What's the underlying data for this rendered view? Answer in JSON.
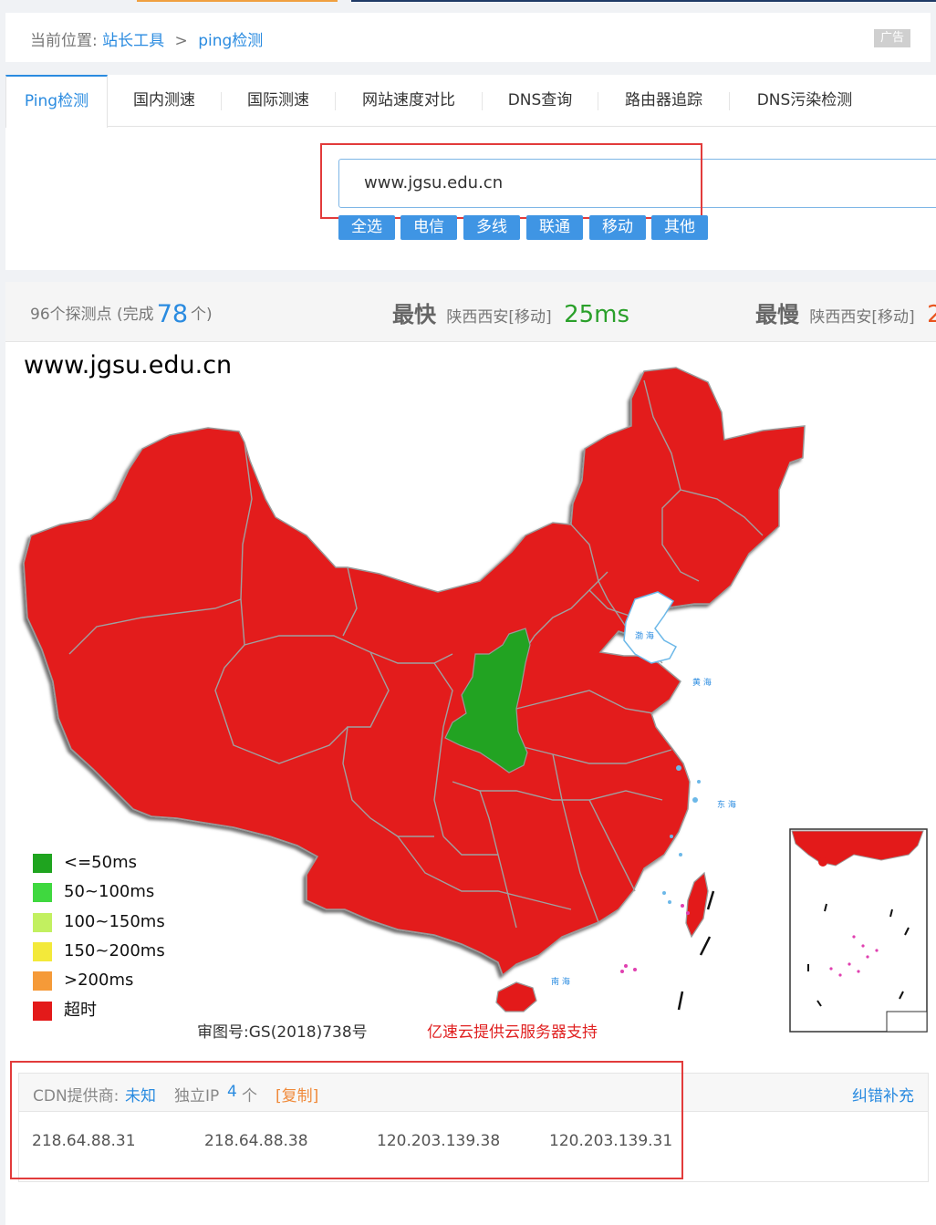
{
  "breadcrumb": {
    "prefix": "当前位置:",
    "link1": "站长工具",
    "sep": ">",
    "link2": "ping检测",
    "ad": "广告"
  },
  "tabs": [
    {
      "label": "Ping检测",
      "active": true
    },
    {
      "label": "国内测速"
    },
    {
      "label": "国际测速"
    },
    {
      "label": "网站速度对比"
    },
    {
      "label": "DNS查询"
    },
    {
      "label": "路由器追踪"
    },
    {
      "label": "DNS污染检测"
    }
  ],
  "query": {
    "value": "www.jgsu.edu.cn"
  },
  "filters": [
    "全选",
    "电信",
    "多线",
    "联通",
    "移动",
    "其他"
  ],
  "summary": {
    "nodes_text": "96个探测点",
    "done_prefix": "(完成",
    "done_count": "78",
    "done_suffix": "个)",
    "fastest_label": "最快",
    "fastest_loc": "陕西西安[移动]",
    "fastest_value": "25ms",
    "slowest_label": "最慢",
    "slowest_loc": "陕西西安[移动]",
    "slowest_value": "2"
  },
  "map": {
    "title": "www.jgsu.edu.cn",
    "approval": "审图号:GS(2018)738号",
    "sponsor": "亿速云提供云服务器支持",
    "colors": {
      "timeout": "#e31a1a",
      "fast": "#22a322",
      "border": "#aaaaaa"
    }
  },
  "legend": [
    {
      "label": "<=50ms",
      "color": "#1fa41f"
    },
    {
      "label": "50~100ms",
      "color": "#3fd83f"
    },
    {
      "label": "100~150ms",
      "color": "#c2f060"
    },
    {
      "label": "150~200ms",
      "color": "#f3e93a"
    },
    {
      "label": ">200ms",
      "color": "#f59a38"
    },
    {
      "label": "超时",
      "color": "#e31a1a"
    }
  ],
  "cdn": {
    "provider_label": "CDN提供商:",
    "provider_value": "未知",
    "ip_label": "独立IP",
    "ip_count": "4",
    "ip_unit": "个",
    "copy_label": "[复制]",
    "report_label": "纠错补充",
    "ips": [
      "218.64.88.31",
      "218.64.88.38",
      "120.203.139.38",
      "120.203.139.31"
    ]
  }
}
